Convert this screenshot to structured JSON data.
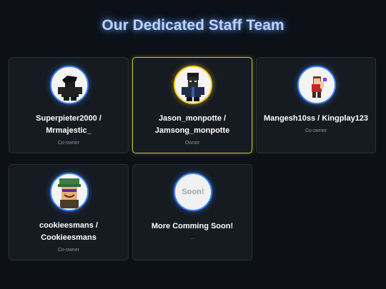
{
  "header": {
    "title": "Our Dedicated Staff Team"
  },
  "colors": {
    "background": "#0d1117",
    "card": "#161b22",
    "accent_blue": "#3b82f6",
    "owner_gold": "#facc15",
    "title_glow": "#b8d4ff"
  },
  "staff": [
    {
      "name_line1": "Superpieter2000 /",
      "name_line2": "Mrmajestic_",
      "role": "Co-owner",
      "avatar_icon": "roblox-avatar-icon"
    },
    {
      "name_line1": "Jason_monpotte /",
      "name_line2": "Jamsong_monpotte",
      "role": "Owner",
      "avatar_icon": "roblox-avatar-icon"
    },
    {
      "name_line1": "Mangesh10ss / Kingplay123",
      "name_line2": "",
      "role": "Co-owner",
      "avatar_icon": "roblox-avatar-icon"
    },
    {
      "name_line1": "cookieesmans /",
      "name_line2": "Cookieesmans",
      "role": "Co-owner",
      "avatar_icon": "roblox-avatar-icon"
    },
    {
      "name_line1": "More Comming Soon!",
      "name_line2": "",
      "role": "...",
      "avatar_text": "Soon!"
    }
  ]
}
